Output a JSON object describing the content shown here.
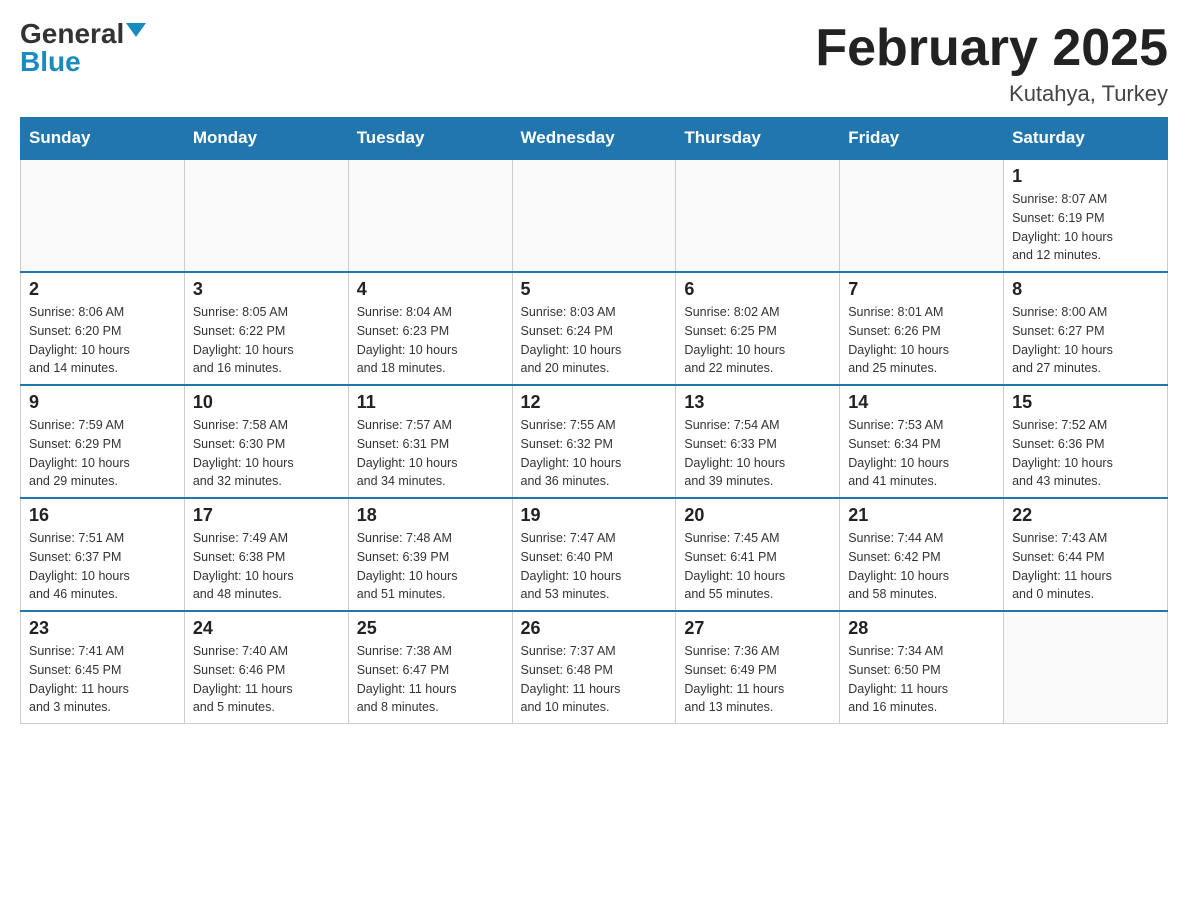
{
  "header": {
    "logo_general": "General",
    "logo_blue": "Blue",
    "month_title": "February 2025",
    "location": "Kutahya, Turkey"
  },
  "days_of_week": [
    "Sunday",
    "Monday",
    "Tuesday",
    "Wednesday",
    "Thursday",
    "Friday",
    "Saturday"
  ],
  "weeks": [
    [
      {
        "day": "",
        "info": ""
      },
      {
        "day": "",
        "info": ""
      },
      {
        "day": "",
        "info": ""
      },
      {
        "day": "",
        "info": ""
      },
      {
        "day": "",
        "info": ""
      },
      {
        "day": "",
        "info": ""
      },
      {
        "day": "1",
        "info": "Sunrise: 8:07 AM\nSunset: 6:19 PM\nDaylight: 10 hours\nand 12 minutes."
      }
    ],
    [
      {
        "day": "2",
        "info": "Sunrise: 8:06 AM\nSunset: 6:20 PM\nDaylight: 10 hours\nand 14 minutes."
      },
      {
        "day": "3",
        "info": "Sunrise: 8:05 AM\nSunset: 6:22 PM\nDaylight: 10 hours\nand 16 minutes."
      },
      {
        "day": "4",
        "info": "Sunrise: 8:04 AM\nSunset: 6:23 PM\nDaylight: 10 hours\nand 18 minutes."
      },
      {
        "day": "5",
        "info": "Sunrise: 8:03 AM\nSunset: 6:24 PM\nDaylight: 10 hours\nand 20 minutes."
      },
      {
        "day": "6",
        "info": "Sunrise: 8:02 AM\nSunset: 6:25 PM\nDaylight: 10 hours\nand 22 minutes."
      },
      {
        "day": "7",
        "info": "Sunrise: 8:01 AM\nSunset: 6:26 PM\nDaylight: 10 hours\nand 25 minutes."
      },
      {
        "day": "8",
        "info": "Sunrise: 8:00 AM\nSunset: 6:27 PM\nDaylight: 10 hours\nand 27 minutes."
      }
    ],
    [
      {
        "day": "9",
        "info": "Sunrise: 7:59 AM\nSunset: 6:29 PM\nDaylight: 10 hours\nand 29 minutes."
      },
      {
        "day": "10",
        "info": "Sunrise: 7:58 AM\nSunset: 6:30 PM\nDaylight: 10 hours\nand 32 minutes."
      },
      {
        "day": "11",
        "info": "Sunrise: 7:57 AM\nSunset: 6:31 PM\nDaylight: 10 hours\nand 34 minutes."
      },
      {
        "day": "12",
        "info": "Sunrise: 7:55 AM\nSunset: 6:32 PM\nDaylight: 10 hours\nand 36 minutes."
      },
      {
        "day": "13",
        "info": "Sunrise: 7:54 AM\nSunset: 6:33 PM\nDaylight: 10 hours\nand 39 minutes."
      },
      {
        "day": "14",
        "info": "Sunrise: 7:53 AM\nSunset: 6:34 PM\nDaylight: 10 hours\nand 41 minutes."
      },
      {
        "day": "15",
        "info": "Sunrise: 7:52 AM\nSunset: 6:36 PM\nDaylight: 10 hours\nand 43 minutes."
      }
    ],
    [
      {
        "day": "16",
        "info": "Sunrise: 7:51 AM\nSunset: 6:37 PM\nDaylight: 10 hours\nand 46 minutes."
      },
      {
        "day": "17",
        "info": "Sunrise: 7:49 AM\nSunset: 6:38 PM\nDaylight: 10 hours\nand 48 minutes."
      },
      {
        "day": "18",
        "info": "Sunrise: 7:48 AM\nSunset: 6:39 PM\nDaylight: 10 hours\nand 51 minutes."
      },
      {
        "day": "19",
        "info": "Sunrise: 7:47 AM\nSunset: 6:40 PM\nDaylight: 10 hours\nand 53 minutes."
      },
      {
        "day": "20",
        "info": "Sunrise: 7:45 AM\nSunset: 6:41 PM\nDaylight: 10 hours\nand 55 minutes."
      },
      {
        "day": "21",
        "info": "Sunrise: 7:44 AM\nSunset: 6:42 PM\nDaylight: 10 hours\nand 58 minutes."
      },
      {
        "day": "22",
        "info": "Sunrise: 7:43 AM\nSunset: 6:44 PM\nDaylight: 11 hours\nand 0 minutes."
      }
    ],
    [
      {
        "day": "23",
        "info": "Sunrise: 7:41 AM\nSunset: 6:45 PM\nDaylight: 11 hours\nand 3 minutes."
      },
      {
        "day": "24",
        "info": "Sunrise: 7:40 AM\nSunset: 6:46 PM\nDaylight: 11 hours\nand 5 minutes."
      },
      {
        "day": "25",
        "info": "Sunrise: 7:38 AM\nSunset: 6:47 PM\nDaylight: 11 hours\nand 8 minutes."
      },
      {
        "day": "26",
        "info": "Sunrise: 7:37 AM\nSunset: 6:48 PM\nDaylight: 11 hours\nand 10 minutes."
      },
      {
        "day": "27",
        "info": "Sunrise: 7:36 AM\nSunset: 6:49 PM\nDaylight: 11 hours\nand 13 minutes."
      },
      {
        "day": "28",
        "info": "Sunrise: 7:34 AM\nSunset: 6:50 PM\nDaylight: 11 hours\nand 16 minutes."
      },
      {
        "day": "",
        "info": ""
      }
    ]
  ]
}
